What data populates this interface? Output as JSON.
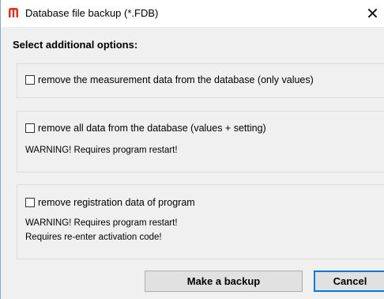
{
  "window": {
    "title": "Database file backup (*.FDB)",
    "close_glyph": "✕",
    "app_icon": "m-logo-icon",
    "accent_color": "#e0301e"
  },
  "heading": "Select additional options:",
  "options": [
    {
      "label": "remove the measurement data from the database (only values)",
      "checked": false,
      "warnings": []
    },
    {
      "label": "remove all data from the database (values + setting)",
      "checked": false,
      "warnings": [
        "WARNING! Requires program restart!"
      ]
    },
    {
      "label": "remove registration data of program",
      "checked": false,
      "warnings": [
        "WARNING! Requires program restart!",
        "Requires re-enter activation code!"
      ]
    }
  ],
  "buttons": {
    "backup_label": "Make a backup",
    "cancel_label": "Cancel"
  }
}
